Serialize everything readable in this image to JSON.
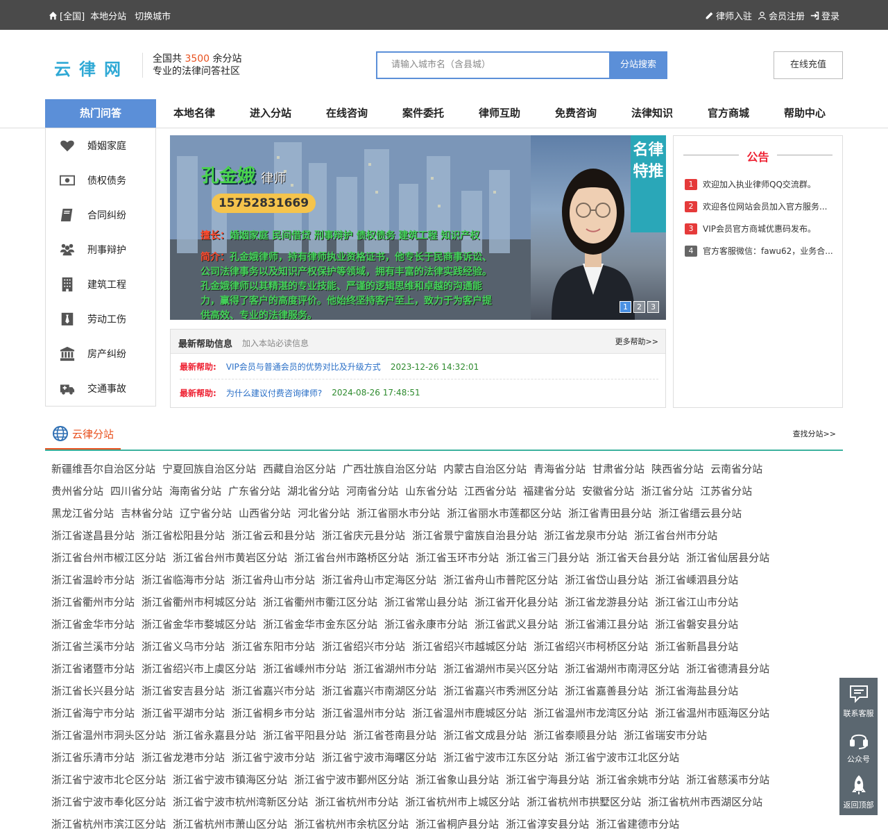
{
  "topbar": {
    "area": "[全国]",
    "local": "本地分站",
    "switch_city": "切换城市",
    "lawyer_join": "律师入驻",
    "register": "会员注册",
    "login": "登录"
  },
  "header": {
    "logo": "云律网",
    "slogan_prefix": "全国共",
    "slogan_num": "3500",
    "slogan_suffix": "余分站",
    "slogan_line2": "专业的法律问答社区",
    "search_placeholder": "请输入城市名（含县城）",
    "search_button": "分站搜索",
    "recharge": "在线充值"
  },
  "nav": {
    "hot": "热门问答",
    "items": [
      "本地名律",
      "进入分站",
      "在线咨询",
      "案件委托",
      "律师互助",
      "免费咨询",
      "法律知识",
      "官方商城",
      "帮助中心"
    ]
  },
  "categories": [
    "婚姻家庭",
    "债权债务",
    "合同纠纷",
    "刑事辩护",
    "建筑工程",
    "劳动工伤",
    "房产纠纷",
    "交通事故"
  ],
  "banner": {
    "name": "孔金娥",
    "title": "律师",
    "phone": "15752831669",
    "skill_label": "擅长：",
    "skill": "婚姻家庭 民间借贷 刑事辩护 债权债务 建筑工程 知识产权",
    "intro_label": "简介：",
    "intro": "孔金娥律师，持有律师执业资格证书，他专长于民商事诉讼、公司法律事务以及知识产权保护等领域，拥有丰富的法律实践经验。孔金娥律师以其精湛的专业技能、严谨的逻辑思维和卓越的沟通能力，赢得了客户的高度评价。他始终坚持客户至上，致力于为客户提供高效、专业的法律服务。",
    "vtab": "名律特推",
    "dots": [
      "1",
      "2",
      "3"
    ]
  },
  "help": {
    "title": "最新帮助信息",
    "sub": "加入本站必读信息",
    "more": "更多帮助>>",
    "rows": [
      {
        "tag": "最新帮助:",
        "text": "VIP会员与普通会员的优势对比及升级方式",
        "date": "2023-12-26 14:32:01"
      },
      {
        "tag": "最新帮助:",
        "text": "为什么建议付费咨询律师?",
        "date": "2024-08-26 17:48:51"
      }
    ]
  },
  "notice": {
    "title": "公告",
    "items": [
      {
        "n": "1",
        "text": "欢迎加入执业律师QQ交流群。"
      },
      {
        "n": "2",
        "text": "欢迎各位网站会员加入官方服务..."
      },
      {
        "n": "3",
        "text": "VIP会员官方商城优惠码发布。"
      },
      {
        "n": "4",
        "text": "官方客服微信：fawu62，业务合..."
      }
    ]
  },
  "stations": {
    "title": "云律分站",
    "more": "查找分站>>",
    "list": [
      [
        "新疆维吾尔自治区分站",
        "宁夏回族自治区分站",
        "西藏自治区分站",
        "广西壮族自治区分站",
        "内蒙古自治区分站",
        "青海省分站",
        "甘肃省分站",
        "陕西省分站",
        "云南省分站"
      ],
      [
        "贵州省分站",
        "四川省分站",
        "海南省分站",
        "广东省分站",
        "湖北省分站",
        "河南省分站",
        "山东省分站",
        "江西省分站",
        "福建省分站",
        "安徽省分站",
        "浙江省分站",
        "江苏省分站"
      ],
      [
        "黑龙江省分站",
        "吉林省分站",
        "辽宁省分站",
        "山西省分站",
        "河北省分站",
        "浙江省丽水市分站",
        "浙江省丽水市莲都区分站",
        "浙江省青田县分站",
        "浙江省缙云县分站"
      ],
      [
        "浙江省遂昌县分站",
        "浙江省松阳县分站",
        "浙江省云和县分站",
        "浙江省庆元县分站",
        "浙江省景宁畲族自治县分站",
        "浙江省龙泉市分站",
        "浙江省台州市分站"
      ],
      [
        "浙江省台州市椒江区分站",
        "浙江省台州市黄岩区分站",
        "浙江省台州市路桥区分站",
        "浙江省玉环市分站",
        "浙江省三门县分站",
        "浙江省天台县分站",
        "浙江省仙居县分站"
      ],
      [
        "浙江省温岭市分站",
        "浙江省临海市分站",
        "浙江省舟山市分站",
        "浙江省舟山市定海区分站",
        "浙江省舟山市普陀区分站",
        "浙江省岱山县分站",
        "浙江省嵊泗县分站"
      ],
      [
        "浙江省衢州市分站",
        "浙江省衢州市柯城区分站",
        "浙江省衢州市衢江区分站",
        "浙江省常山县分站",
        "浙江省开化县分站",
        "浙江省龙游县分站",
        "浙江省江山市分站"
      ],
      [
        "浙江省金华市分站",
        "浙江省金华市婺城区分站",
        "浙江省金华市金东区分站",
        "浙江省永康市分站",
        "浙江省武义县分站",
        "浙江省浦江县分站",
        "浙江省磐安县分站"
      ],
      [
        "浙江省兰溪市分站",
        "浙江省义乌市分站",
        "浙江省东阳市分站",
        "浙江省绍兴市分站",
        "浙江省绍兴市越城区分站",
        "浙江省绍兴市柯桥区分站",
        "浙江省新昌县分站"
      ],
      [
        "浙江省诸暨市分站",
        "浙江省绍兴市上虞区分站",
        "浙江省嵊州市分站",
        "浙江省湖州市分站",
        "浙江省湖州市吴兴区分站",
        "浙江省湖州市南浔区分站",
        "浙江省德清县分站"
      ],
      [
        "浙江省长兴县分站",
        "浙江省安吉县分站",
        "浙江省嘉兴市分站",
        "浙江省嘉兴市南湖区分站",
        "浙江省嘉兴市秀洲区分站",
        "浙江省嘉善县分站",
        "浙江省海盐县分站"
      ],
      [
        "浙江省海宁市分站",
        "浙江省平湖市分站",
        "浙江省桐乡市分站",
        "浙江省温州市分站",
        "浙江省温州市鹿城区分站",
        "浙江省温州市龙湾区分站",
        "浙江省温州市瓯海区分站"
      ],
      [
        "浙江省温州市洞头区分站",
        "浙江省永嘉县分站",
        "浙江省平阳县分站",
        "浙江省苍南县分站",
        "浙江省文成县分站",
        "浙江省泰顺县分站",
        "浙江省瑞安市分站"
      ],
      [
        "浙江省乐清市分站",
        "浙江省龙港市分站",
        "浙江省宁波市分站",
        "浙江省宁波市海曙区分站",
        "浙江省宁波市江东区分站",
        "浙江省宁波市江北区分站"
      ],
      [
        "浙江省宁波市北仑区分站",
        "浙江省宁波市镇海区分站",
        "浙江省宁波市鄞州区分站",
        "浙江省象山县分站",
        "浙江省宁海县分站",
        "浙江省余姚市分站",
        "浙江省慈溪市分站"
      ],
      [
        "浙江省宁波市奉化区分站",
        "浙江省宁波市杭州湾新区分站",
        "浙江省杭州市分站",
        "浙江省杭州市上城区分站",
        "浙江省杭州市拱墅区分站",
        "浙江省杭州市西湖区分站"
      ],
      [
        "浙江省杭州市滨江区分站",
        "浙江省杭州市萧山区分站",
        "浙江省杭州市余杭区分站",
        "浙江省桐庐县分站",
        "浙江省淳安县分站",
        "浙江省建德市分站"
      ]
    ]
  },
  "float": {
    "service": "联系客服",
    "wechat": "公众号",
    "top": "返回顶部"
  }
}
